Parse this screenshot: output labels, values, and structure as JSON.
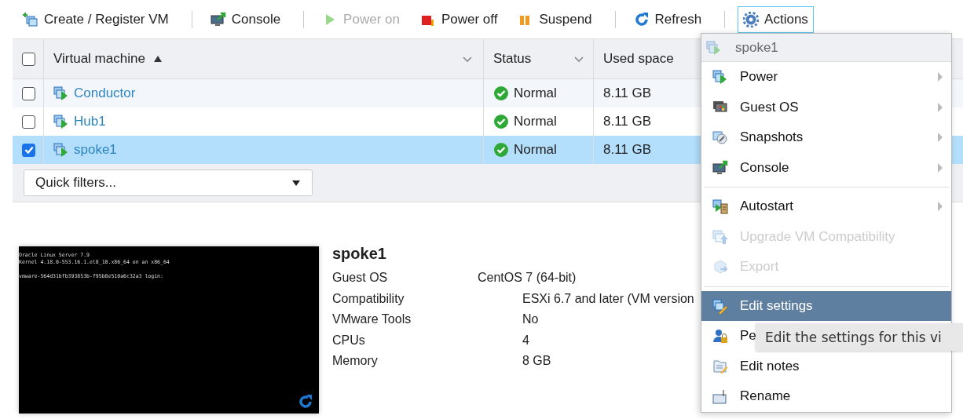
{
  "toolbar": [
    {
      "label": "Create / Register VM",
      "disabled": false,
      "selected": false
    },
    {
      "label": "Console",
      "disabled": false,
      "selected": false
    },
    {
      "label": "Power on",
      "disabled": true,
      "selected": false
    },
    {
      "label": "Power off",
      "disabled": false,
      "selected": false
    },
    {
      "label": "Suspend",
      "disabled": false,
      "selected": false
    },
    {
      "label": "Refresh",
      "disabled": false,
      "selected": false
    },
    {
      "label": "Actions",
      "disabled": false,
      "selected": true
    }
  ],
  "table": {
    "select_all": {
      "checked": false
    },
    "columns": [
      "Virtual machine",
      "Status",
      "Used space"
    ],
    "rows": [
      {
        "checked": false,
        "selected": false,
        "name": "Conductor",
        "status": "Normal",
        "used_space": "8.11 GB"
      },
      {
        "checked": false,
        "selected": false,
        "name": "Hub1",
        "status": "Normal",
        "used_space": "8.11 GB"
      },
      {
        "checked": true,
        "selected": true,
        "name": "spoke1",
        "status": "Normal",
        "used_space": "8.11 GB"
      }
    ],
    "quick_filters": {
      "value": "Quick filters..."
    }
  },
  "details": {
    "console_lines": [
      "Oracle Linux Server 7.9",
      "Kernel 4.18.0-553.16.1.el8_10.x86_64 on an x86_64",
      "vmware-564d31bfb393853b-f95b8e510a6c32a3 login:"
    ],
    "name": "spoke1",
    "fields": [
      {
        "label": "Guest OS",
        "value": "CentOS 7 (64-bit)"
      },
      {
        "label": "Compatibility",
        "value": "ESXi 6.7 and later (VM version"
      },
      {
        "label": "VMware Tools",
        "value": "No"
      },
      {
        "label": "CPUs",
        "value": "4"
      },
      {
        "label": "Memory",
        "value": "8 GB"
      }
    ]
  },
  "actions_menu": {
    "title": "spoke1",
    "items": [
      {
        "kind": "item",
        "label": "Power",
        "disabled": false,
        "selected": false,
        "submenu": true
      },
      {
        "kind": "item",
        "label": "Guest OS",
        "disabled": false,
        "selected": false,
        "submenu": true
      },
      {
        "kind": "item",
        "label": "Snapshots",
        "disabled": false,
        "selected": false,
        "submenu": true
      },
      {
        "kind": "item",
        "label": "Console",
        "disabled": false,
        "selected": false,
        "submenu": true
      },
      {
        "kind": "separator"
      },
      {
        "kind": "item",
        "label": "Autostart",
        "disabled": false,
        "selected": false,
        "submenu": true
      },
      {
        "kind": "item",
        "label": "Upgrade VM Compatibility",
        "disabled": true,
        "selected": false,
        "submenu": false
      },
      {
        "kind": "item",
        "label": "Export",
        "disabled": true,
        "selected": false,
        "submenu": false
      },
      {
        "kind": "separator"
      },
      {
        "kind": "item",
        "label": "Edit settings",
        "disabled": false,
        "selected": true,
        "submenu": false
      },
      {
        "kind": "item",
        "label": "Pe",
        "disabled": false,
        "selected": false,
        "submenu": false
      },
      {
        "kind": "item",
        "label": "Edit notes",
        "disabled": false,
        "selected": false,
        "submenu": false
      },
      {
        "kind": "item",
        "label": "Rename",
        "disabled": false,
        "selected": false,
        "submenu": false
      }
    ]
  },
  "tooltip": {
    "text": "Edit the settings for this vi"
  }
}
